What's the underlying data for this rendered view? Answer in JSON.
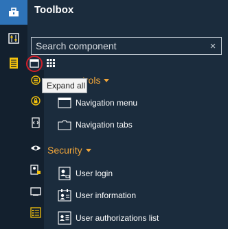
{
  "panel": {
    "title": "Toolbox"
  },
  "search": {
    "placeholder": "Search component",
    "clear_glyph": "×"
  },
  "toolbar": {
    "expand_all_tooltip": "Expand all"
  },
  "categories": [
    {
      "label_visible": "trols",
      "items": [
        {
          "label": "Navigation menu",
          "icon": "window-icon"
        },
        {
          "label": "Navigation tabs",
          "icon": "folder-tabs-icon"
        }
      ]
    },
    {
      "label_visible": "Security",
      "items": [
        {
          "label": "User login",
          "icon": "user-card-icon"
        },
        {
          "label": "User information",
          "icon": "user-info-icon"
        },
        {
          "label": "User authorizations list",
          "icon": "user-list-icon"
        }
      ]
    }
  ],
  "colors": {
    "rail_bg": "#13202e",
    "panel_bg": "#1b2c3d",
    "accent_blue": "#2e73b8",
    "category_orange": "#f0a53a",
    "highlight_red": "#d11f2a",
    "icon_yellow": "#f4c20d"
  }
}
